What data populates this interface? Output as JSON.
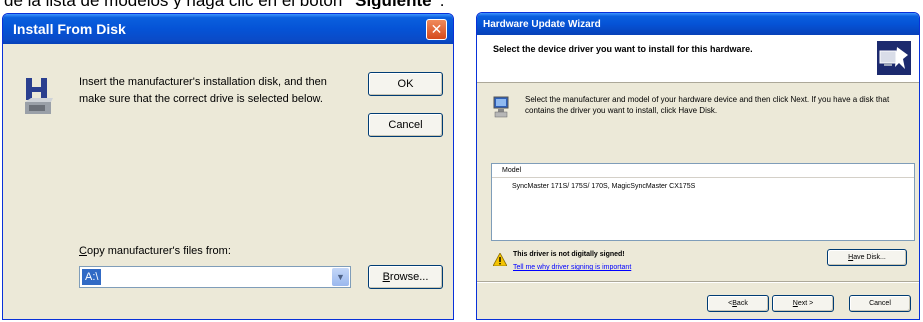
{
  "caption": {
    "text": "de la lista de modelos y haga clic en el botón ",
    "bold": "\"Siguiente\"",
    "end": "."
  },
  "install_from_disk": {
    "title": "Install From Disk",
    "close_icon": "close-icon",
    "message": "Insert the manufacturer's installation disk, and then make sure that the correct drive is selected below.",
    "ok_label": "OK",
    "cancel_label": "Cancel",
    "copy_label_accel": "C",
    "copy_label_rest": "opy manufacturer's files from:",
    "combo_value": "A:\\",
    "browse_accel": "B",
    "browse_rest": "rowse...",
    "icons": {
      "disk": "floppy-disk-icon",
      "dropdown": "chevron-down-icon"
    },
    "colors": {
      "title_bar": "#0553d6",
      "close": "#d5491c",
      "dialog_bg": "#ece9d8",
      "selection": "#316ac5"
    }
  },
  "hardware_wizard": {
    "title": "Hardware Update Wizard",
    "header_title": "Select the device driver you want to install for this hardware.",
    "instruction": "Select the manufacturer and model of your hardware device and then click Next. If you have a disk that contains the driver you want to install, click Have Disk.",
    "list_header": "Model",
    "list_items": [
      "SyncMaster 171S/ 175S/ 170S, MagicSyncMaster CX175S"
    ],
    "warning_text": "This driver is not digitally signed!",
    "warning_link": "Tell me why driver signing is important",
    "have_disk_accel": "H",
    "have_disk_rest": "ave Disk...",
    "back_pre": "< ",
    "back_accel": "B",
    "back_rest": "ack",
    "next_accel": "N",
    "next_rest": "ext >",
    "cancel_label": "Cancel",
    "icons": {
      "header": "hardware-wizard-icon",
      "device": "monitor-device-icon",
      "warning": "warning-icon"
    }
  }
}
